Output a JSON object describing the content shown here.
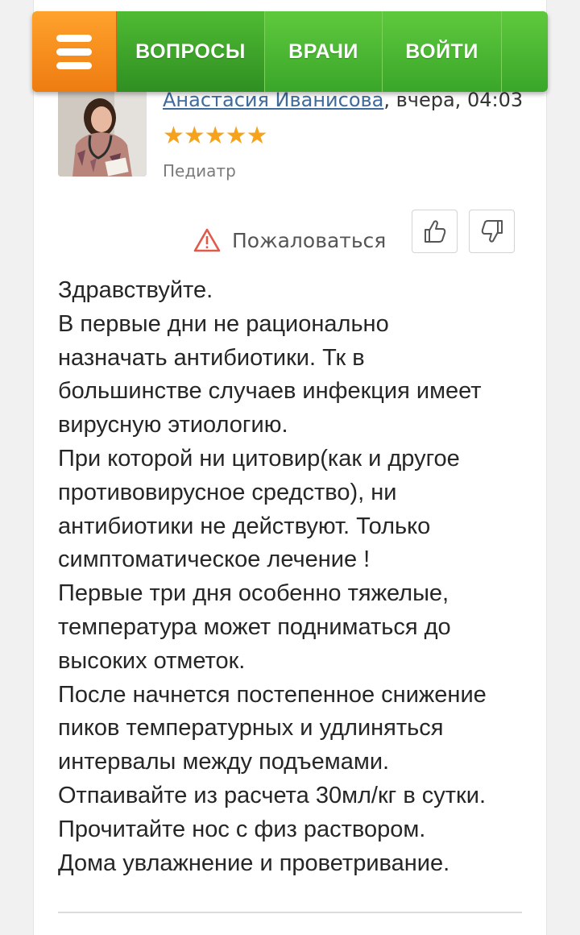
{
  "nav": {
    "items": [
      "ВОПРОСЫ",
      "ВРАЧИ",
      "ВОЙТИ"
    ],
    "accent_orange": "#f08a1c",
    "accent_green": "#46b22f"
  },
  "answer": {
    "author_name": "Анастасия Иванисова",
    "posted_time": ", вчера, 04:03",
    "rating": 5,
    "stars": "★★★★★",
    "specialty": "Педиатр",
    "report_label": "Пожаловаться",
    "lines": [
      "Здравствуйте.",
      "В первые дни не рационально",
      "назначать антибиотики. Тк в",
      "большинстве случаев инфекция имеет",
      "вирусную этиологию.",
      "При которой ни цитовир(как и другое",
      "противовирусное средство), ни",
      "антибиотики не действуют. Только",
      "симптоматическое лечение !",
      "Первые три дня особенно тяжелые,",
      "температура может подниматься до",
      "высоких отметок.",
      "После начнется постепенное снижение",
      "пиков температурных и удлиняться",
      "интервалы между подъемами.",
      "Отпаивайте из расчета 30мл/кг в сутки.",
      "Прочитайте нос с физ раствором.",
      "Дома увлажнение и проветривание."
    ]
  },
  "icons": {
    "menu": "hamburger-icon",
    "warning": "warning-triangle-icon",
    "like": "thumbs-up-icon",
    "dislike": "thumbs-down-icon"
  }
}
